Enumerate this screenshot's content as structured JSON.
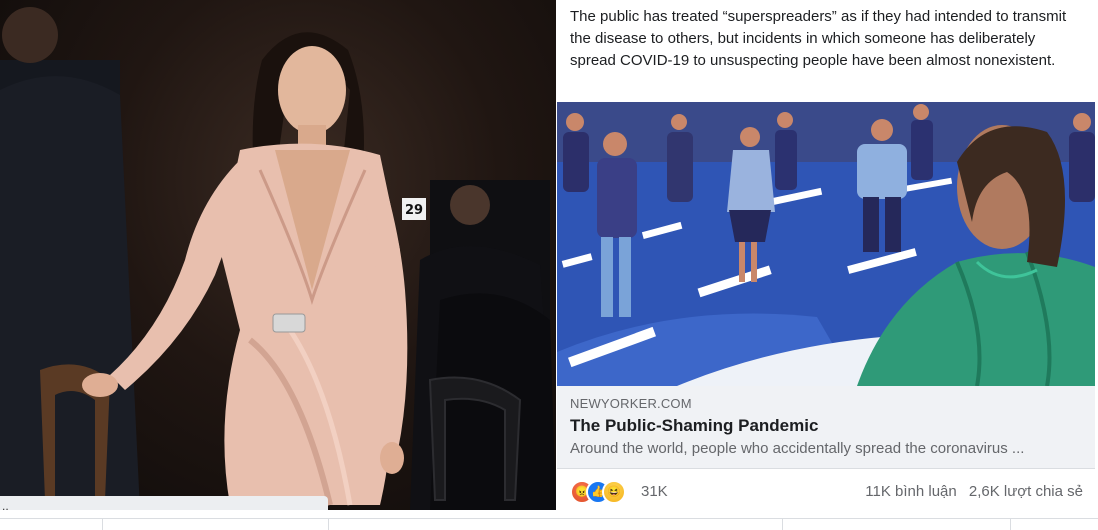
{
  "left_photo": {
    "table_number": "29",
    "caption": ".."
  },
  "post": {
    "text": "The public has treated “superspreaders” as if they had intended to transmit the disease to others, but incidents in which someone has deliberately spread COVID-19 to unsuspecting people have been almost nonexistent.",
    "link": {
      "domain": "NEWYORKER.COM",
      "title": "The Public-Shaming Pandemic",
      "description": "Around the world, people who accidentally spread the coronavirus ..."
    },
    "reactions": {
      "icons": [
        "angry-icon",
        "like-icon",
        "haha-icon"
      ],
      "count": "31K"
    },
    "comments": "11K bình luận",
    "shares": "2,6K lượt chia sẻ"
  },
  "colors": {
    "facebook_blue": "#1877f2",
    "link_meta_bg": "#f0f2f5",
    "illustration_blue": "#2f55b5"
  }
}
